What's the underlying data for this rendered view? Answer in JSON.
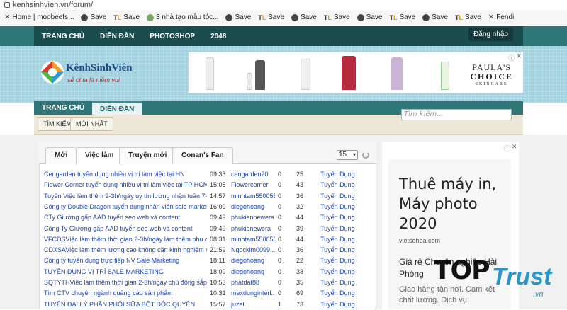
{
  "browser": {
    "url": "kenhsinhvien.vn/forum/",
    "bookmarks": [
      {
        "label": "Home | moobeefs...",
        "icon": "x-icon"
      },
      {
        "label": "Save",
        "icon": "globe-icon"
      },
      {
        "label": "Save",
        "icon": "tl-icon"
      },
      {
        "label": "3 nhà tạo mẫu tóc...",
        "icon": "image-icon"
      },
      {
        "label": "Save",
        "icon": "globe-icon"
      },
      {
        "label": "Save",
        "icon": "tl-icon"
      },
      {
        "label": "Save",
        "icon": "globe-icon"
      },
      {
        "label": "Save",
        "icon": "tl-icon"
      },
      {
        "label": "Save",
        "icon": "globe-icon"
      },
      {
        "label": "Save",
        "icon": "tl-icon"
      },
      {
        "label": "Save",
        "icon": "globe-icon"
      },
      {
        "label": "Save",
        "icon": "tl-icon"
      },
      {
        "label": "Fendi",
        "icon": "x-icon"
      }
    ]
  },
  "nav": {
    "items": [
      "TRANG CHỦ",
      "DIỄN ĐÀN",
      "PHOTOSHOP",
      "2048"
    ],
    "login": "Đăng nhập"
  },
  "logo": {
    "name": "KênhSinhViên",
    "tagline": "sẻ chia là niềm vui"
  },
  "ad_banner": {
    "brand_line1": "PAULA'S",
    "brand_line2": "CHOICE",
    "brand_line3": "SKINCARE"
  },
  "subnav": {
    "tabs": [
      "TRANG CHỦ",
      "DIỄN ĐÀN"
    ],
    "active": "DIỄN ĐÀN"
  },
  "search": {
    "placeholder": "Tìm kiếm..."
  },
  "buttons": {
    "search": "TÌM KIẾM",
    "newest": "MỚI NHẤT"
  },
  "forum": {
    "tabs": [
      "Mới",
      "Việc làm",
      "Truyện mới",
      "Conan's Fan"
    ],
    "active_tab": "Việc làm",
    "per_page": "15",
    "rows": [
      {
        "title": "Cengarden tuyển dụng nhiều vị trí làm việc tại HN",
        "time": "09:33",
        "user": "cengarden20",
        "replies": "0",
        "views": "25",
        "forum": "Tuyển Dụng"
      },
      {
        "title": "Flower Corner tuyển dụng nhiều vị trí làm việc tại TP HCM",
        "time": "15:05",
        "user": "Flowercorner",
        "replies": "0",
        "views": "43",
        "forum": "Tuyển Dụng"
      },
      {
        "title": "Tuyển Việc làm thêm 2-3h/ngày uy tín lương nhận tuần 7-...",
        "time": "14:57",
        "user": "minhtam550055",
        "replies": "0",
        "views": "36",
        "forum": "Tuyển Dụng"
      },
      {
        "title": "Công ty Double Dragon tuyển dụng nhân viên sale marketing",
        "time": "16:09",
        "user": "diegohoang",
        "replies": "0",
        "views": "32",
        "forum": "Tuyển Dụng"
      },
      {
        "title": "CTy Giường gấp AAD tuyển seo web và content",
        "time": "09:49",
        "user": "phukiennewera",
        "replies": "0",
        "views": "44",
        "forum": "Tuyển Dụng"
      },
      {
        "title": "Công Ty Giường gấp AAD tuyển seo web và content",
        "time": "09:49",
        "user": "phukienewera",
        "replies": "0",
        "views": "39",
        "forum": "Tuyển Dụng"
      },
      {
        "title": "VFCDSViệc làm thêm thời gian 2-3h/ngày làm thêm phụ cô...",
        "time": "08:31",
        "user": "minhtam550055",
        "replies": "0",
        "views": "44",
        "forum": "Tuyển Dụng"
      },
      {
        "title": "CDXSAViệc làm thêm lương cao không cần kinh nghiệm và...",
        "time": "21:59",
        "user": "Ngockim0099...",
        "replies": "0",
        "views": "36",
        "forum": "Tuyển Dụng"
      },
      {
        "title": "Công ty tuyển dụng trực tiếp NV Sale Marketing",
        "time": "18:11",
        "user": "diegohoang",
        "replies": "0",
        "views": "22",
        "forum": "Tuyển Dụng"
      },
      {
        "title": "TUYỂN DỤNG VỊ TRÍ SALE MARKETING",
        "time": "18:09",
        "user": "diegohoang",
        "replies": "0",
        "views": "33",
        "forum": "Tuyển Dụng"
      },
      {
        "title": "SQTYTHViệc làm thêm thời gian 2-3h/ngày chủ động sắp x...",
        "time": "10:53",
        "user": "phatdat88",
        "replies": "0",
        "views": "35",
        "forum": "Tuyển Dụng"
      },
      {
        "title": "Tìm CTV chuyên ngành quảng cáo sản phẩm",
        "time": "10:31",
        "user": "mexdunginterl...",
        "replies": "0",
        "views": "69",
        "forum": "Tuyển Dụng"
      },
      {
        "title": "TUYỂN ĐẠI LÝ PHÂN PHỐI SỮA BỘT ĐỘC QUYỀN",
        "time": "15:57",
        "user": "juzell",
        "replies": "1",
        "views": "73",
        "forum": "Tuyển Dụng"
      }
    ]
  },
  "side_ad": {
    "headline": "Thuê máy in, Máy photo 2020",
    "domain": "vietsohoa.com",
    "subhead": "Giá rẻ Chuyên nghiệp Hải Phòng",
    "body": "Giao hàng tận nơi. Cam kết chất lượng. Dịch vụ"
  },
  "watermark": {
    "top": "TOP",
    "trust": "Trust",
    "vn": ".vn"
  }
}
